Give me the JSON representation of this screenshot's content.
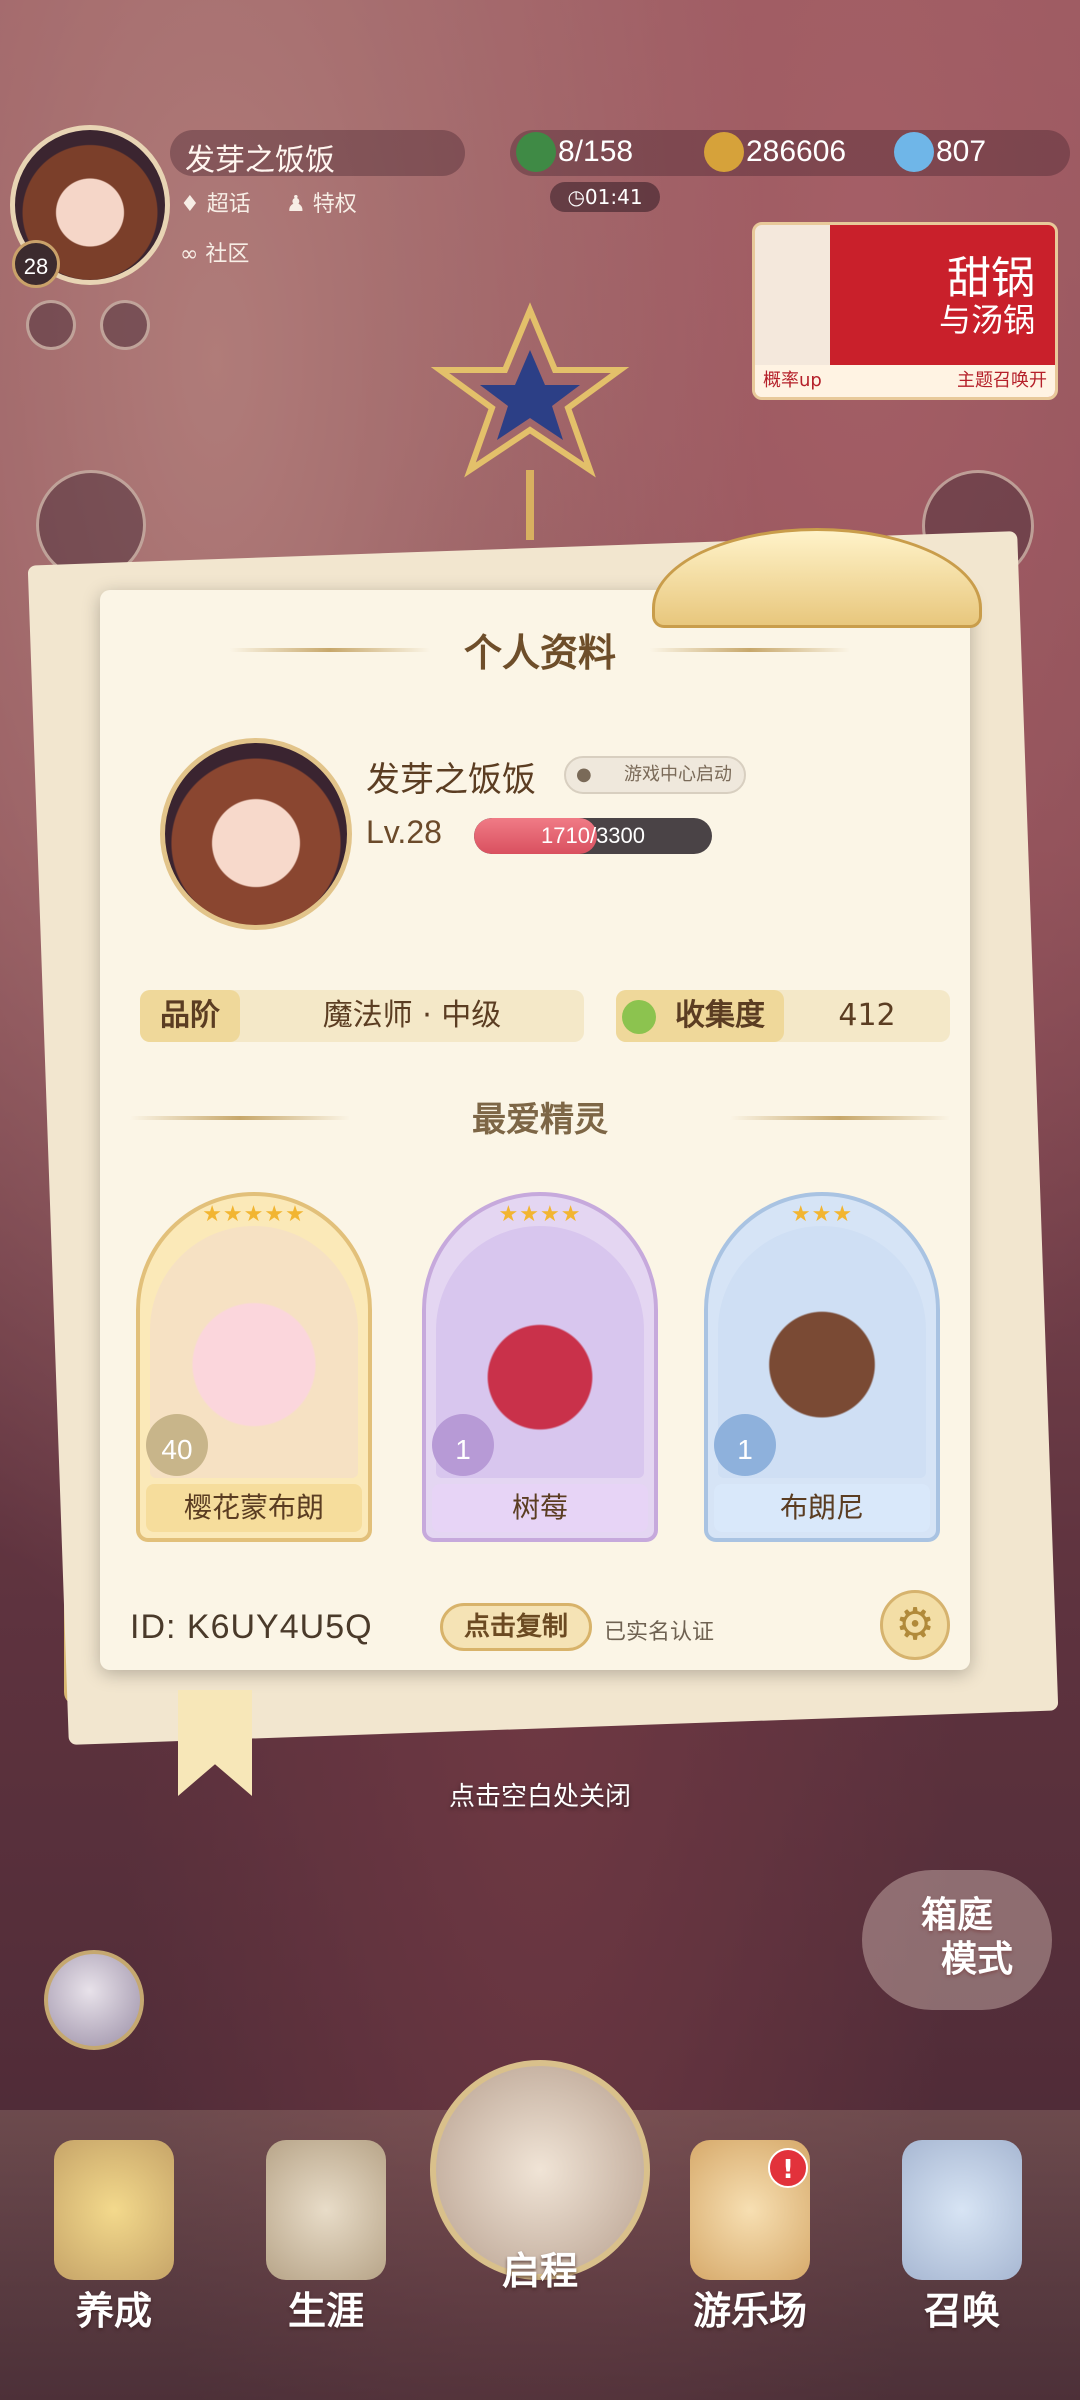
{
  "hud": {
    "level": "28",
    "player_name": "发芽之饭饭",
    "links": [
      "超话",
      "特权",
      "社区"
    ],
    "clover": "8/158",
    "coins": "286606",
    "crystals": "807",
    "timer": "01:41",
    "banner": {
      "title_line1": "甜锅",
      "title_line2": "与汤锅",
      "footer_left": "概率up",
      "footer_right": "主题召唤开"
    }
  },
  "profile": {
    "title": "个人资料",
    "name": "发芽之饭饭",
    "tag": "游戏中心启动",
    "level": "Lv.28",
    "exp_current": "1710",
    "exp_total": "3300",
    "exp_fraction": 0.518,
    "rank_key": "品阶",
    "rank_value": "魔法师 · 中级",
    "collection_key": "收集度",
    "collection_value": "412",
    "favorites_title": "最爱精灵",
    "favorites": [
      {
        "name": "樱花蒙布朗",
        "level": "40",
        "stars": "★★★★★",
        "color": "#f8e6b4"
      },
      {
        "name": "树莓",
        "level": "1",
        "stars": "★★★★",
        "color": "#e4d6f2"
      },
      {
        "name": "布朗尼",
        "level": "1",
        "stars": "★★★",
        "color": "#d6e4f6"
      }
    ],
    "id_label": "ID:",
    "id_value": "K6UY4U5Q",
    "copy_label": "点击复制",
    "verified": "已实名认证"
  },
  "close_hint": "点击空白处关闭",
  "mode_button": [
    "箱庭",
    "模式"
  ],
  "nav": {
    "items": [
      "养成",
      "生涯",
      "启程",
      "游乐场",
      "召唤"
    ],
    "alert": "!"
  },
  "colors": {
    "panel_bg": "#fbf5e6",
    "accent_gold": "#d9b871",
    "exp_fill": "#d9505f"
  }
}
